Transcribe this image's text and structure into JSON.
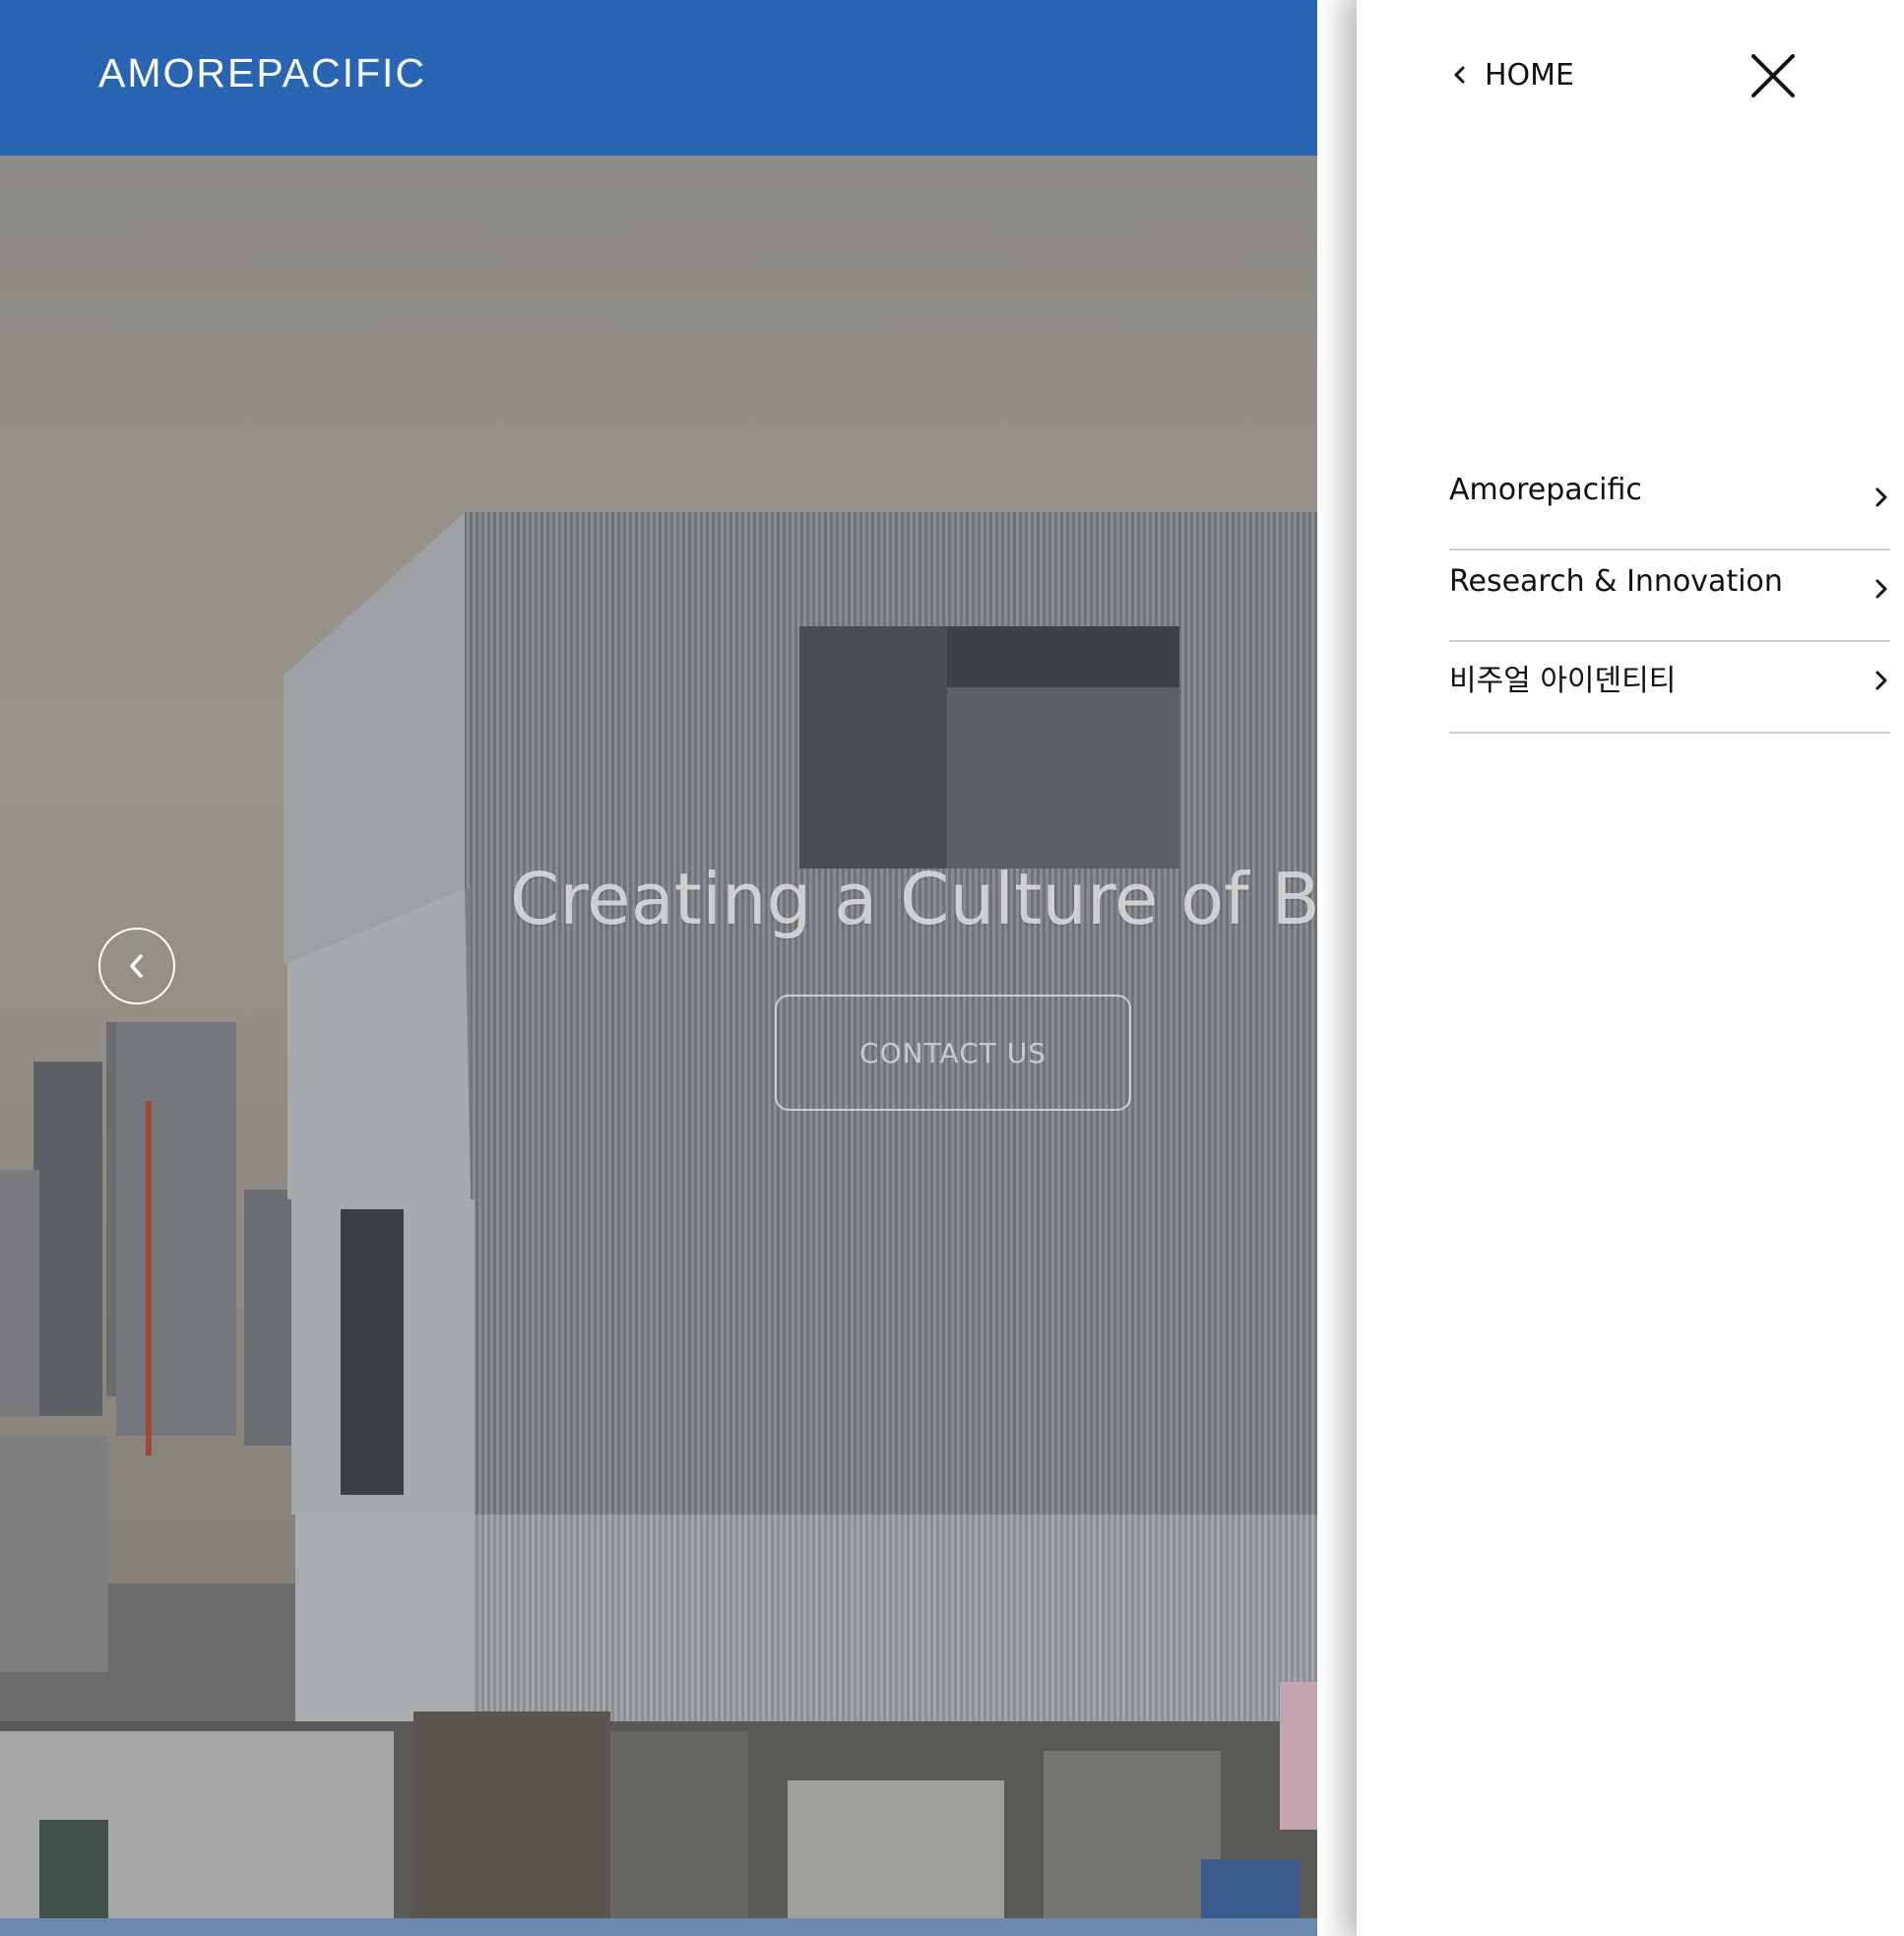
{
  "site": {
    "logo": {
      "part1": "AMORE",
      "part2": "PACIFIC"
    },
    "hero": {
      "title": "Creating a Culture of Beau",
      "cta_label": "CONTACT US",
      "prev_icon": "chevron-left-icon"
    },
    "colors": {
      "header_bg": "#2a65b4"
    }
  },
  "drawer": {
    "home_label": "HOME",
    "home_icon": "chevron-left-icon",
    "close_icon": "close-icon",
    "items": [
      {
        "label": "Amorepacific",
        "icon": "chevron-right-icon"
      },
      {
        "label": "Research & Innovation",
        "icon": "chevron-right-icon"
      },
      {
        "label": "비주얼 아이덴티티",
        "icon": "chevron-right-icon"
      }
    ]
  }
}
